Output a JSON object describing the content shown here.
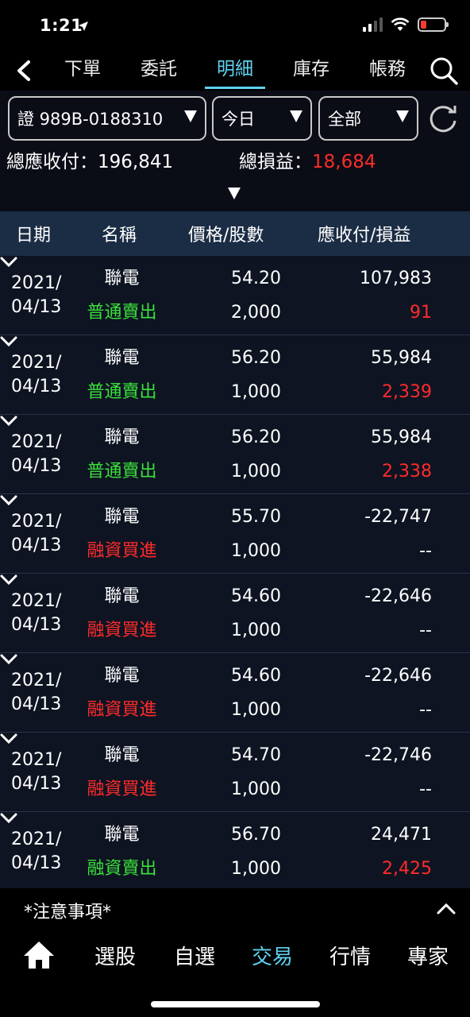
{
  "status": {
    "time": "1:21"
  },
  "nav": {
    "tabs": [
      {
        "label": "下單"
      },
      {
        "label": "委託"
      },
      {
        "label": "明細"
      },
      {
        "label": "庫存"
      },
      {
        "label": "帳務"
      }
    ],
    "active_tab": "明細"
  },
  "filters": {
    "account": "證 989B-0188310",
    "date": "今日",
    "type": "全部"
  },
  "summary": {
    "total_label": "總應收付：196,841",
    "pl_label": "總損益：",
    "pl_value": "18,684"
  },
  "table": {
    "headers": {
      "date": "日期",
      "name": "名稱",
      "price": "價格/股數",
      "amount": "應收付/損益"
    },
    "rows": [
      {
        "date1": "2021/",
        "date2": "04/13",
        "name": "聯電",
        "action": "普通賣出",
        "action_color": "green",
        "price": "54.20",
        "qty": "2,000",
        "amount": "107,983",
        "pl": "91",
        "pl_color": "red"
      },
      {
        "date1": "2021/",
        "date2": "04/13",
        "name": "聯電",
        "action": "普通賣出",
        "action_color": "green",
        "price": "56.20",
        "qty": "1,000",
        "amount": "55,984",
        "pl": "2,339",
        "pl_color": "red"
      },
      {
        "date1": "2021/",
        "date2": "04/13",
        "name": "聯電",
        "action": "普通賣出",
        "action_color": "green",
        "price": "56.20",
        "qty": "1,000",
        "amount": "55,984",
        "pl": "2,338",
        "pl_color": "red"
      },
      {
        "date1": "2021/",
        "date2": "04/13",
        "name": "聯電",
        "action": "融資買進",
        "action_color": "red",
        "price": "55.70",
        "qty": "1,000",
        "amount": "-22,747",
        "pl": "--",
        "pl_color": "white"
      },
      {
        "date1": "2021/",
        "date2": "04/13",
        "name": "聯電",
        "action": "融資買進",
        "action_color": "red",
        "price": "54.60",
        "qty": "1,000",
        "amount": "-22,646",
        "pl": "--",
        "pl_color": "white"
      },
      {
        "date1": "2021/",
        "date2": "04/13",
        "name": "聯電",
        "action": "融資買進",
        "action_color": "red",
        "price": "54.60",
        "qty": "1,000",
        "amount": "-22,646",
        "pl": "--",
        "pl_color": "white"
      },
      {
        "date1": "2021/",
        "date2": "04/13",
        "name": "聯電",
        "action": "融資買進",
        "action_color": "red",
        "price": "54.70",
        "qty": "1,000",
        "amount": "-22,746",
        "pl": "--",
        "pl_color": "white"
      },
      {
        "date1": "2021/",
        "date2": "04/13",
        "name": "聯電",
        "action": "融資賣出",
        "action_color": "green",
        "price": "56.70",
        "qty": "1,000",
        "amount": "24,471",
        "pl": "2,425",
        "pl_color": "red"
      }
    ]
  },
  "notice": {
    "label": "*注意事項*"
  },
  "bottom_nav": {
    "items": [
      {
        "label": "選股"
      },
      {
        "label": "自選"
      },
      {
        "label": "交易"
      },
      {
        "label": "行情"
      },
      {
        "label": "專家"
      }
    ],
    "active": "交易"
  },
  "colors": {
    "accent": "#5fd2f0",
    "gain": "#ff2b2b",
    "sell": "#3be03b"
  }
}
